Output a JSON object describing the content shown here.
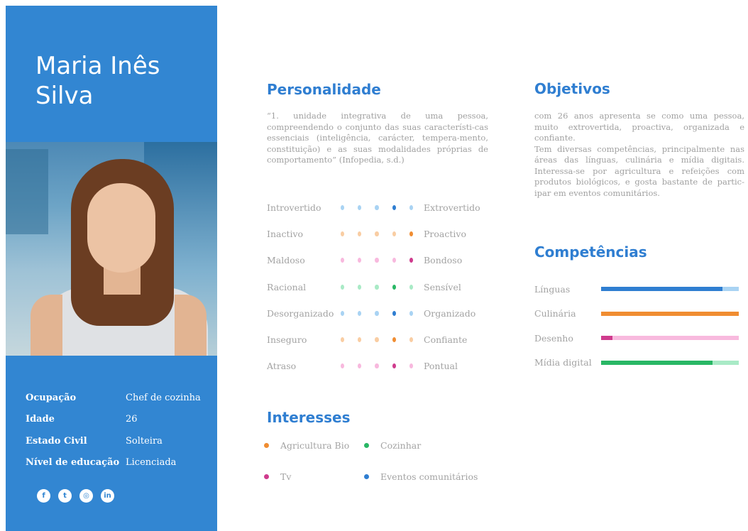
{
  "profile": {
    "first_name": "Maria Inês",
    "last_name": "Silva",
    "info": [
      {
        "label": "Ocupação",
        "value": "Chef de cozinha"
      },
      {
        "label": "Idade",
        "value": "26"
      },
      {
        "label": "Estado Civil",
        "value": "Solteira"
      },
      {
        "label": "Nível de educação",
        "value": "Licenciada"
      }
    ],
    "social": [
      {
        "icon": "facebook-icon",
        "glyph": "f"
      },
      {
        "icon": "twitter-icon",
        "glyph": "t"
      },
      {
        "icon": "instagram-icon",
        "glyph": "◎"
      },
      {
        "icon": "linkedin-icon",
        "glyph": "in"
      }
    ]
  },
  "personality": {
    "title": "Personalidade",
    "quote": "“1. unidade integrativa de uma pessoa, compreendendo o conjunto das suas característi-cas essenciais (inteligência, carácter, tempera-mento, constituição) e as suas modalidades próprias de comportamento”  (Infopedia, s.d.)",
    "traits": [
      {
        "left": "Introvertido",
        "right": "Extrovertido",
        "selected": 4,
        "light": "#a9d3f3",
        "dark": "#2f7ed1"
      },
      {
        "left": "Inactivo",
        "right": "Proactivo",
        "selected": 5,
        "light": "#f9cda3",
        "dark": "#f08d32"
      },
      {
        "left": "Maldoso",
        "right": "Bondoso",
        "selected": 5,
        "light": "#f8b9de",
        "dark": "#cf3b8d"
      },
      {
        "left": "Racional",
        "right": "Sensível",
        "selected": 4,
        "light": "#a9eac6",
        "dark": "#29b765"
      },
      {
        "left": "Desorganizado",
        "right": "Organizado",
        "selected": 4,
        "light": "#a9d3f3",
        "dark": "#2f7ed1"
      },
      {
        "left": "Inseguro",
        "right": "Confiante",
        "selected": 4,
        "light": "#f9cda3",
        "dark": "#f08d32"
      },
      {
        "left": "Atraso",
        "right": "Pontual",
        "selected": 4,
        "light": "#f8b9de",
        "dark": "#cf3b8d"
      }
    ]
  },
  "objectives": {
    "title": "Objetivos",
    "text": "com 26 anos apresenta se como uma pessoa, muito extrovertida, proactiva, organizada e confiante.\nTem diversas competências, principalmente nas áreas das línguas, culinária e mídia digitais. Interessa-se por agricultura e refeições com produtos biológicos, e gosta bastante de partic-ipar em eventos comunitários."
  },
  "skills": {
    "title": "Competências",
    "items": [
      {
        "label": "Línguas",
        "level": 0.88,
        "light": "#a9d3f3",
        "dark": "#2f7ed1"
      },
      {
        "label": "Culinária",
        "level": 1.0,
        "light": "#f9cda3",
        "dark": "#f08d32"
      },
      {
        "label": "Desenho",
        "level": 0.08,
        "light": "#f8b9de",
        "dark": "#cf3b8d"
      },
      {
        "label": "Mídia digital",
        "level": 0.81,
        "light": "#a9eac6",
        "dark": "#29b765"
      }
    ]
  },
  "interests": {
    "title": "Interesses",
    "items": [
      {
        "label": "Agricultura Bio",
        "color": "#f08d32"
      },
      {
        "label": "Cozinhar",
        "color": "#29b765"
      },
      {
        "label": "Tv",
        "color": "#cf3b8d"
      },
      {
        "label": "Eventos comunitários",
        "color": "#2f7ed1"
      }
    ]
  }
}
